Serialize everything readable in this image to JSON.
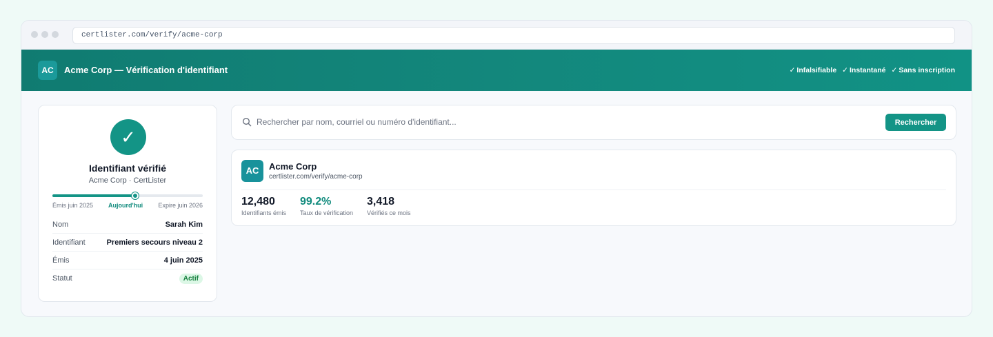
{
  "browser": {
    "url": "certlister.com/verify/acme-corp"
  },
  "header": {
    "logo_initials": "AC",
    "title": "Acme Corp — Vérification d'identifiant",
    "badges": [
      "Infalsifiable",
      "Instantané",
      "Sans inscription"
    ],
    "check_glyph": "✓"
  },
  "credential": {
    "status_icon": "✓",
    "title": "Identifiant vérifié",
    "subtitle": "Acme Corp · CertLister",
    "timeline": {
      "start_label": "Émis juin 2025",
      "today_label": "Aujourd'hui",
      "end_label": "Expire juin 2026",
      "progress": 0.55
    },
    "fields": [
      {
        "label": "Nom",
        "value": "Sarah Kim"
      },
      {
        "label": "Identifiant",
        "value": "Premiers secours niveau 2"
      },
      {
        "label": "Émis",
        "value": "4 juin 2025"
      },
      {
        "label": "Statut",
        "value": "Actif"
      }
    ]
  },
  "search": {
    "placeholder": "Rechercher par nom, courriel ou numéro d'identifiant...",
    "button_label": "Rechercher"
  },
  "org": {
    "logo_initials": "AC",
    "name": "Acme Corp",
    "url": "certlister.com/verify/acme-corp",
    "stats": [
      {
        "value": "12,480",
        "label": "Identifiants émis"
      },
      {
        "value": "99.2%",
        "label": "Taux de vérification"
      },
      {
        "value": "3,418",
        "label": "Vérifiés ce mois"
      }
    ]
  },
  "colors": {
    "brand": "#139486",
    "header_bg": "#107b71",
    "success": "#15803d"
  }
}
